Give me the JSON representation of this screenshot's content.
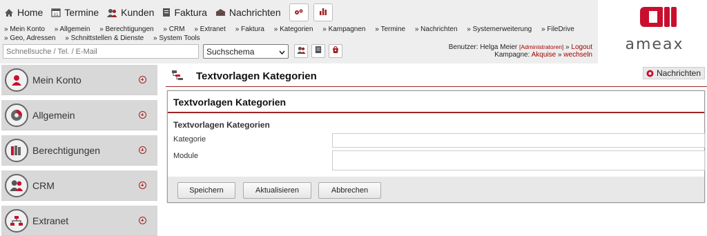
{
  "main_nav": {
    "home": "Home",
    "termine": "Termine",
    "kunden": "Kunden",
    "faktura": "Faktura",
    "nachrichten": "Nachrichten"
  },
  "sub_nav": [
    "Mein Konto",
    "Allgemein",
    "Berechtigungen",
    "CRM",
    "Extranet",
    "Faktura",
    "Kategorien",
    "Kampagnen",
    "Termine",
    "Nachrichten",
    "Systemerweiterung",
    "FileDrive",
    "Geo, Adressen",
    "Schnittstellen & Dienste",
    "System Tools"
  ],
  "search": {
    "placeholder": "Schnellsuche / Tel. / E-Mail",
    "schema_value": "Suchschema"
  },
  "user": {
    "label": "Benutzer:",
    "name": "Helga Meier",
    "role": "[Administratoren]",
    "logout": "Logout",
    "campaign_label": "Kampagne:",
    "campaign": "Akquise",
    "switch": "wechseln"
  },
  "logo": {
    "text": "ameax"
  },
  "sidebar": {
    "items": [
      {
        "label": "Mein Konto"
      },
      {
        "label": "Allgemein"
      },
      {
        "label": "Berechtigungen"
      },
      {
        "label": "CRM"
      },
      {
        "label": "Extranet"
      }
    ]
  },
  "page": {
    "title": "Textvorlagen Kategorien",
    "messages_button": "Nachrichten"
  },
  "panel": {
    "title": "Textvorlagen Kategorien",
    "section_title": "Textvorlagen Kategorien",
    "fields": {
      "kategorie_label": "Kategorie",
      "module_label": "Module",
      "kategorie_value": "",
      "module_value": ""
    },
    "buttons": {
      "save": "Speichern",
      "update": "Aktualisieren",
      "cancel": "Abbrechen"
    }
  },
  "colors": {
    "accent": "#a12222",
    "logo_red": "#c8102e",
    "sidebar_bg": "#d8d8d8"
  }
}
